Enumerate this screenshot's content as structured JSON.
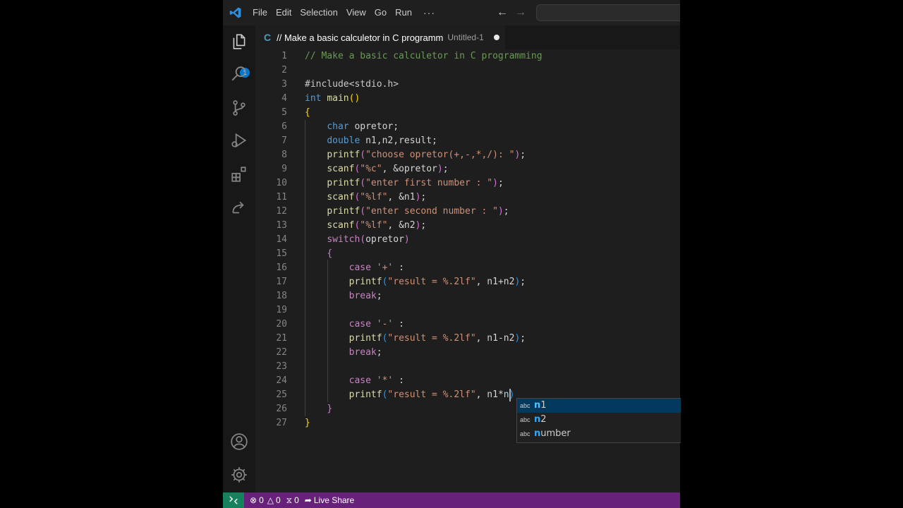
{
  "menu": {
    "items": [
      "File",
      "Edit",
      "Selection",
      "View",
      "Go",
      "Run"
    ],
    "more": "···"
  },
  "activity": {
    "explorer_badge": "1"
  },
  "tab": {
    "lang_icon": "C",
    "title": "// Make a basic calculetor in C programm",
    "filename": "Untitled-1"
  },
  "editor": {
    "lines": [
      [
        [
          "// Make a basic calculetor in C programming",
          "#6a9955"
        ]
      ],
      [],
      [
        [
          "#include<stdio.h>",
          "#c8c8c8"
        ]
      ],
      [
        [
          "int",
          "#569cd6"
        ],
        [
          " ",
          "#d4d4d4"
        ],
        [
          "main",
          "#dcdcaa"
        ],
        [
          "()",
          "#ffd700"
        ]
      ],
      [
        [
          "{",
          "#ffd700"
        ]
      ],
      [
        [
          "    ",
          "#d4d4d4"
        ],
        [
          "char",
          "#569cd6"
        ],
        [
          " opretor;",
          "#d4d4d4"
        ]
      ],
      [
        [
          "    ",
          "#d4d4d4"
        ],
        [
          "double",
          "#569cd6"
        ],
        [
          " n1,n2,result;",
          "#d4d4d4"
        ]
      ],
      [
        [
          "    ",
          "#d4d4d4"
        ],
        [
          "printf",
          "#dcdcaa"
        ],
        [
          "(",
          "#da70d6"
        ],
        [
          "\"choose opretor(+,-,*,/): \"",
          "#ce9178"
        ],
        [
          ")",
          "#da70d6"
        ],
        [
          ";",
          "#d4d4d4"
        ]
      ],
      [
        [
          "    ",
          "#d4d4d4"
        ],
        [
          "scanf",
          "#dcdcaa"
        ],
        [
          "(",
          "#da70d6"
        ],
        [
          "\"%c\"",
          "#ce9178"
        ],
        [
          ", &opretor",
          "#d4d4d4"
        ],
        [
          ")",
          "#da70d6"
        ],
        [
          ";",
          "#d4d4d4"
        ]
      ],
      [
        [
          "    ",
          "#d4d4d4"
        ],
        [
          "printf",
          "#dcdcaa"
        ],
        [
          "(",
          "#da70d6"
        ],
        [
          "\"enter first number : \"",
          "#ce9178"
        ],
        [
          ")",
          "#da70d6"
        ],
        [
          ";",
          "#d4d4d4"
        ]
      ],
      [
        [
          "    ",
          "#d4d4d4"
        ],
        [
          "scanf",
          "#dcdcaa"
        ],
        [
          "(",
          "#da70d6"
        ],
        [
          "\"%lf\"",
          "#ce9178"
        ],
        [
          ", &n1",
          "#d4d4d4"
        ],
        [
          ")",
          "#da70d6"
        ],
        [
          ";",
          "#d4d4d4"
        ]
      ],
      [
        [
          "    ",
          "#d4d4d4"
        ],
        [
          "printf",
          "#dcdcaa"
        ],
        [
          "(",
          "#da70d6"
        ],
        [
          "\"enter second number : \"",
          "#ce9178"
        ],
        [
          ")",
          "#da70d6"
        ],
        [
          ";",
          "#d4d4d4"
        ]
      ],
      [
        [
          "    ",
          "#d4d4d4"
        ],
        [
          "scanf",
          "#dcdcaa"
        ],
        [
          "(",
          "#da70d6"
        ],
        [
          "\"%lf\"",
          "#ce9178"
        ],
        [
          ", &n2",
          "#d4d4d4"
        ],
        [
          ")",
          "#da70d6"
        ],
        [
          ";",
          "#d4d4d4"
        ]
      ],
      [
        [
          "    ",
          "#d4d4d4"
        ],
        [
          "switch",
          "#c586c0"
        ],
        [
          "(",
          "#da70d6"
        ],
        [
          "opretor",
          "#d4d4d4"
        ],
        [
          ")",
          "#da70d6"
        ]
      ],
      [
        [
          "    ",
          "#d4d4d4"
        ],
        [
          "{",
          "#da70d6"
        ]
      ],
      [
        [
          "        ",
          "#d4d4d4"
        ],
        [
          "case",
          "#c586c0"
        ],
        [
          " ",
          "#d4d4d4"
        ],
        [
          "'+'",
          "#ce9178"
        ],
        [
          " :",
          "#d4d4d4"
        ]
      ],
      [
        [
          "        ",
          "#d4d4d4"
        ],
        [
          "printf",
          "#dcdcaa"
        ],
        [
          "(",
          "#179fff"
        ],
        [
          "\"result = %.2lf\"",
          "#ce9178"
        ],
        [
          ", n1+n2",
          "#d4d4d4"
        ],
        [
          ")",
          "#179fff"
        ],
        [
          ";",
          "#d4d4d4"
        ]
      ],
      [
        [
          "        ",
          "#d4d4d4"
        ],
        [
          "break",
          "#c586c0"
        ],
        [
          ";",
          "#d4d4d4"
        ]
      ],
      [],
      [
        [
          "        ",
          "#d4d4d4"
        ],
        [
          "case",
          "#c586c0"
        ],
        [
          " ",
          "#d4d4d4"
        ],
        [
          "'-'",
          "#ce9178"
        ],
        [
          " :",
          "#d4d4d4"
        ]
      ],
      [
        [
          "        ",
          "#d4d4d4"
        ],
        [
          "printf",
          "#dcdcaa"
        ],
        [
          "(",
          "#179fff"
        ],
        [
          "\"result = %.2lf\"",
          "#ce9178"
        ],
        [
          ", n1-n2",
          "#d4d4d4"
        ],
        [
          ")",
          "#179fff"
        ],
        [
          ";",
          "#d4d4d4"
        ]
      ],
      [
        [
          "        ",
          "#d4d4d4"
        ],
        [
          "break",
          "#c586c0"
        ],
        [
          ";",
          "#d4d4d4"
        ]
      ],
      [],
      [
        [
          "        ",
          "#d4d4d4"
        ],
        [
          "case",
          "#c586c0"
        ],
        [
          " ",
          "#d4d4d4"
        ],
        [
          "'*'",
          "#ce9178"
        ],
        [
          " :",
          "#d4d4d4"
        ]
      ],
      [
        [
          "        ",
          "#d4d4d4"
        ],
        [
          "printf",
          "#dcdcaa"
        ],
        [
          "(",
          "#179fff"
        ],
        [
          "\"result = %.2lf\"",
          "#ce9178"
        ],
        [
          ", n1*",
          "#d4d4d4"
        ],
        [
          "n",
          "#9cdcfe"
        ],
        [
          ")",
          "#179fff"
        ]
      ],
      [
        [
          "    ",
          "#d4d4d4"
        ],
        [
          "}",
          "#da70d6"
        ]
      ],
      [
        [
          "}",
          "#ffd700"
        ]
      ]
    ]
  },
  "suggest": {
    "items": [
      {
        "kind": "abc",
        "match": "n",
        "rest": "1"
      },
      {
        "kind": "abc",
        "match": "n",
        "rest": "2"
      },
      {
        "kind": "abc",
        "match": "n",
        "rest": "umber"
      }
    ]
  },
  "status": {
    "errors": "0",
    "warnings": "0",
    "ports": "0",
    "live_share": "Live Share"
  },
  "colors": {
    "accent": "#0078d4",
    "statusbar": "#68217a",
    "remote": "#16825d",
    "suggest_selected": "#04395e"
  }
}
